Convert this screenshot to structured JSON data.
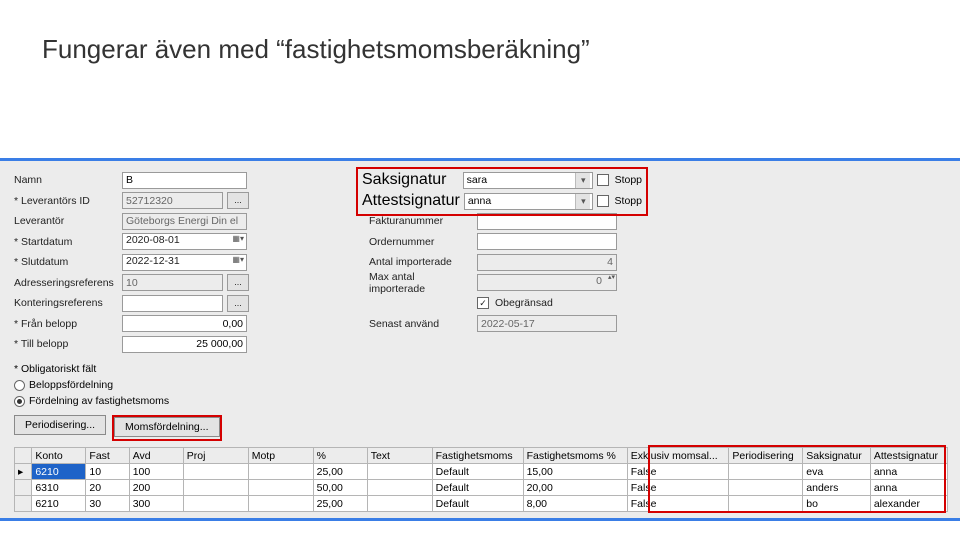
{
  "slide": {
    "title": "Fungerar även med “fastighetsmomsberäkning”"
  },
  "labels": {
    "namn": "Namn",
    "leverantorsId": "* Leverantörs ID",
    "leverantor": "Leverantör",
    "startdatum": "* Startdatum",
    "slutdatum": "* Slutdatum",
    "adrRef": "Adresseringsreferens",
    "kontRef": "Konteringsreferens",
    "franBelopp": "* Från belopp",
    "tillBelopp": "* Till belopp",
    "saksignatur": "Saksignatur",
    "attestsignatur": "Attestsignatur",
    "stopp": "Stopp",
    "fakturanummer": "Fakturanummer",
    "ordernummer": "Ordernummer",
    "antalImp": "Antal importerade",
    "maxAntalImp": "Max antal importerade",
    "obegransad": "Obegränsad",
    "senastAnvand": "Senast använd",
    "obligatoriskt": "* Obligatoriskt fält",
    "radio1": "Beloppsfördelning",
    "radio2": "Fördelning av fastighetsmoms",
    "periodisering": "Periodisering...",
    "momsfordelning": "Momsfördelning..."
  },
  "values": {
    "namn": "B",
    "leverantorsId": "52712320",
    "leverantor": "Göteborgs Energi Din el",
    "startdatum": "2020-08-01",
    "slutdatum": "2022-12-31",
    "adrRef": "10",
    "kontRef": "",
    "franBelopp": "0,00",
    "tillBelopp": "25 000,00",
    "saksignatur": "sara",
    "attestsignatur": "anna",
    "stopp1": false,
    "stopp2": false,
    "antalImp": "4",
    "maxAntalImp": "0",
    "obegransad": true,
    "senastAnvand": "2022-05-17",
    "radioSelected": 2
  },
  "grid": {
    "headers": [
      "Konto",
      "Fast",
      "Avd",
      "Proj",
      "Motp",
      "%",
      "Text",
      "Fastighetsmoms",
      "Fastighetsmoms %",
      "Exklusiv momsal...",
      "Periodisering",
      "Saksignatur",
      "Attestsignatur"
    ],
    "rows": [
      {
        "konto": "6210",
        "fast": "10",
        "avd": "100",
        "proj": "",
        "motp": "",
        "pct": "25,00",
        "text": "",
        "fm": "Default",
        "fmpct": "15,00",
        "exkl": "False",
        "per": "",
        "sak": "eva",
        "att": "anna"
      },
      {
        "konto": "6310",
        "fast": "20",
        "avd": "200",
        "proj": "",
        "motp": "",
        "pct": "50,00",
        "text": "",
        "fm": "Default",
        "fmpct": "20,00",
        "exkl": "False",
        "per": "",
        "sak": "anders",
        "att": "anna"
      },
      {
        "konto": "6210",
        "fast": "30",
        "avd": "300",
        "proj": "",
        "motp": "",
        "pct": "25,00",
        "text": "",
        "fm": "Default",
        "fmpct": "8,00",
        "exkl": "False",
        "per": "",
        "sak": "bo",
        "att": "alexander"
      }
    ]
  }
}
